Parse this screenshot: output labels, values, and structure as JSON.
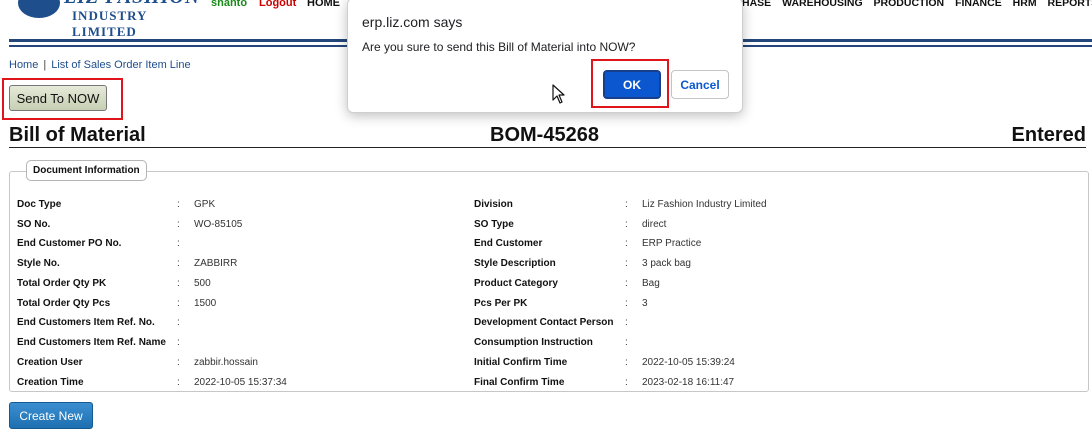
{
  "header": {
    "logo_top": "LIZ FASHION",
    "logo_sub": "INDUSTRY LIMITED",
    "user": "shanto",
    "logout": "Logout",
    "home": "HOME",
    "menu": [
      "HASE",
      "WAREHOUSING",
      "PRODUCTION",
      "FINANCE",
      "HRM",
      "REPORTS"
    ]
  },
  "breadcrumb": {
    "home": "Home",
    "sep": "|",
    "current": "List of Sales Order Item Line"
  },
  "actions": {
    "send": "Send To NOW",
    "create": "Create New"
  },
  "title": {
    "left": "Bill of Material",
    "middle": "BOM-45268",
    "right": "Entered"
  },
  "section": {
    "legend": "Document Information",
    "left_fields": [
      {
        "label": "Doc Type",
        "value": "GPK"
      },
      {
        "label": "SO No.",
        "value": "WO-85105"
      },
      {
        "label": "End Customer PO No.",
        "value": ""
      },
      {
        "label": "Style No.",
        "value": "ZABBIRR"
      },
      {
        "label": "Total Order Qty PK",
        "value": "500"
      },
      {
        "label": "Total Order Qty Pcs",
        "value": "1500"
      },
      {
        "label": "End Customers Item Ref. No.",
        "value": ""
      },
      {
        "label": "End Customers Item Ref. Name",
        "value": ""
      },
      {
        "label": "Creation User",
        "value": "zabbir.hossain"
      },
      {
        "label": "Creation Time",
        "value": "2022-10-05 15:37:34"
      }
    ],
    "right_fields": [
      {
        "label": "Division",
        "value": "Liz Fashion Industry Limited"
      },
      {
        "label": "SO Type",
        "value": "direct"
      },
      {
        "label": "End Customer",
        "value": "ERP Practice"
      },
      {
        "label": "Style Description",
        "value": "3 pack bag"
      },
      {
        "label": "Product Category",
        "value": "Bag"
      },
      {
        "label": "Pcs Per PK",
        "value": "3"
      },
      {
        "label": "Development Contact Person",
        "value": ""
      },
      {
        "label": "Consumption Instruction",
        "value": ""
      },
      {
        "label": "Initial Confirm Time",
        "value": "2022-10-05 15:39:24"
      },
      {
        "label": "Final Confirm Time",
        "value": "2023-02-18 16:11:47"
      }
    ]
  },
  "dialog": {
    "title": "erp.liz.com says",
    "message": "Are you sure to send this Bill of Material into NOW?",
    "ok": "OK",
    "cancel": "Cancel"
  },
  "colors": {
    "accent": "#24467a",
    "highlight": "#e0151c",
    "ok_button": "#0b57d0"
  }
}
